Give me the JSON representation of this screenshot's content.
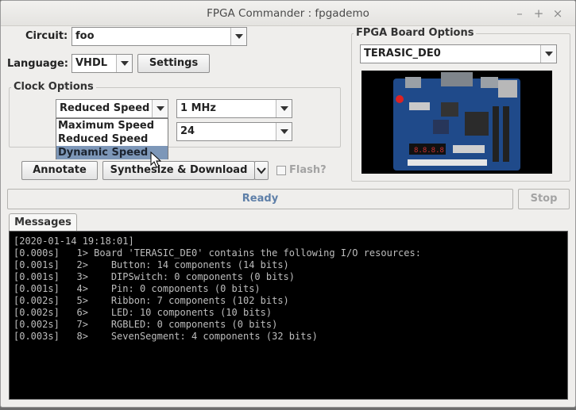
{
  "window": {
    "title": "FPGA Commander : fpgademo",
    "controls": {
      "minimize": "–",
      "maximize": "+",
      "close": "×"
    }
  },
  "circuit": {
    "label": "Circuit:",
    "value": "foo"
  },
  "language": {
    "label": "Language:",
    "value": "VHDL",
    "settings_label": "Settings"
  },
  "clock_options": {
    "title": "Clock Options",
    "speed_mode": "Reduced Speed",
    "frequency": "1 MHz",
    "divider": "24",
    "dropdown_items": [
      "Maximum Speed",
      "Reduced Speed",
      "Dynamic Speed"
    ],
    "highlighted_item": "Dynamic Speed"
  },
  "buttons": {
    "annotate": "Annotate",
    "synthesize": "Synthesize & Download",
    "flash_label": "Flash?",
    "stop": "Stop"
  },
  "board_options": {
    "title": "FPGA Board Options",
    "board": "TERASIC_DE0"
  },
  "status": {
    "text": "Ready"
  },
  "messages_tab": {
    "label": "Messages"
  },
  "messages": [
    "[2020-01-14 19:18:01]",
    "[0.000s]   1> Board 'TERASIC_DE0' contains the following I/O resources:",
    "[0.001s]   2>    Button: 14 components (14 bits)",
    "[0.001s]   3>    DIPSwitch: 0 components (0 bits)",
    "[0.001s]   4>    Pin: 0 components (0 bits)",
    "[0.002s]   5>    Ribbon: 7 components (102 bits)",
    "[0.002s]   6>    LED: 10 components (10 bits)",
    "[0.002s]   7>    RGBLED: 0 components (0 bits)",
    "[0.003s]   8>    SevenSegment: 4 components (32 bits)"
  ],
  "colors": {
    "status_text": "#5e7fa8",
    "dropdown_highlight": "#7d97b8",
    "board_pcb": "#1f4a8a"
  },
  "icons": {
    "cursor": "mouse-pointer-icon",
    "dropdown": "chevron-down-icon"
  }
}
